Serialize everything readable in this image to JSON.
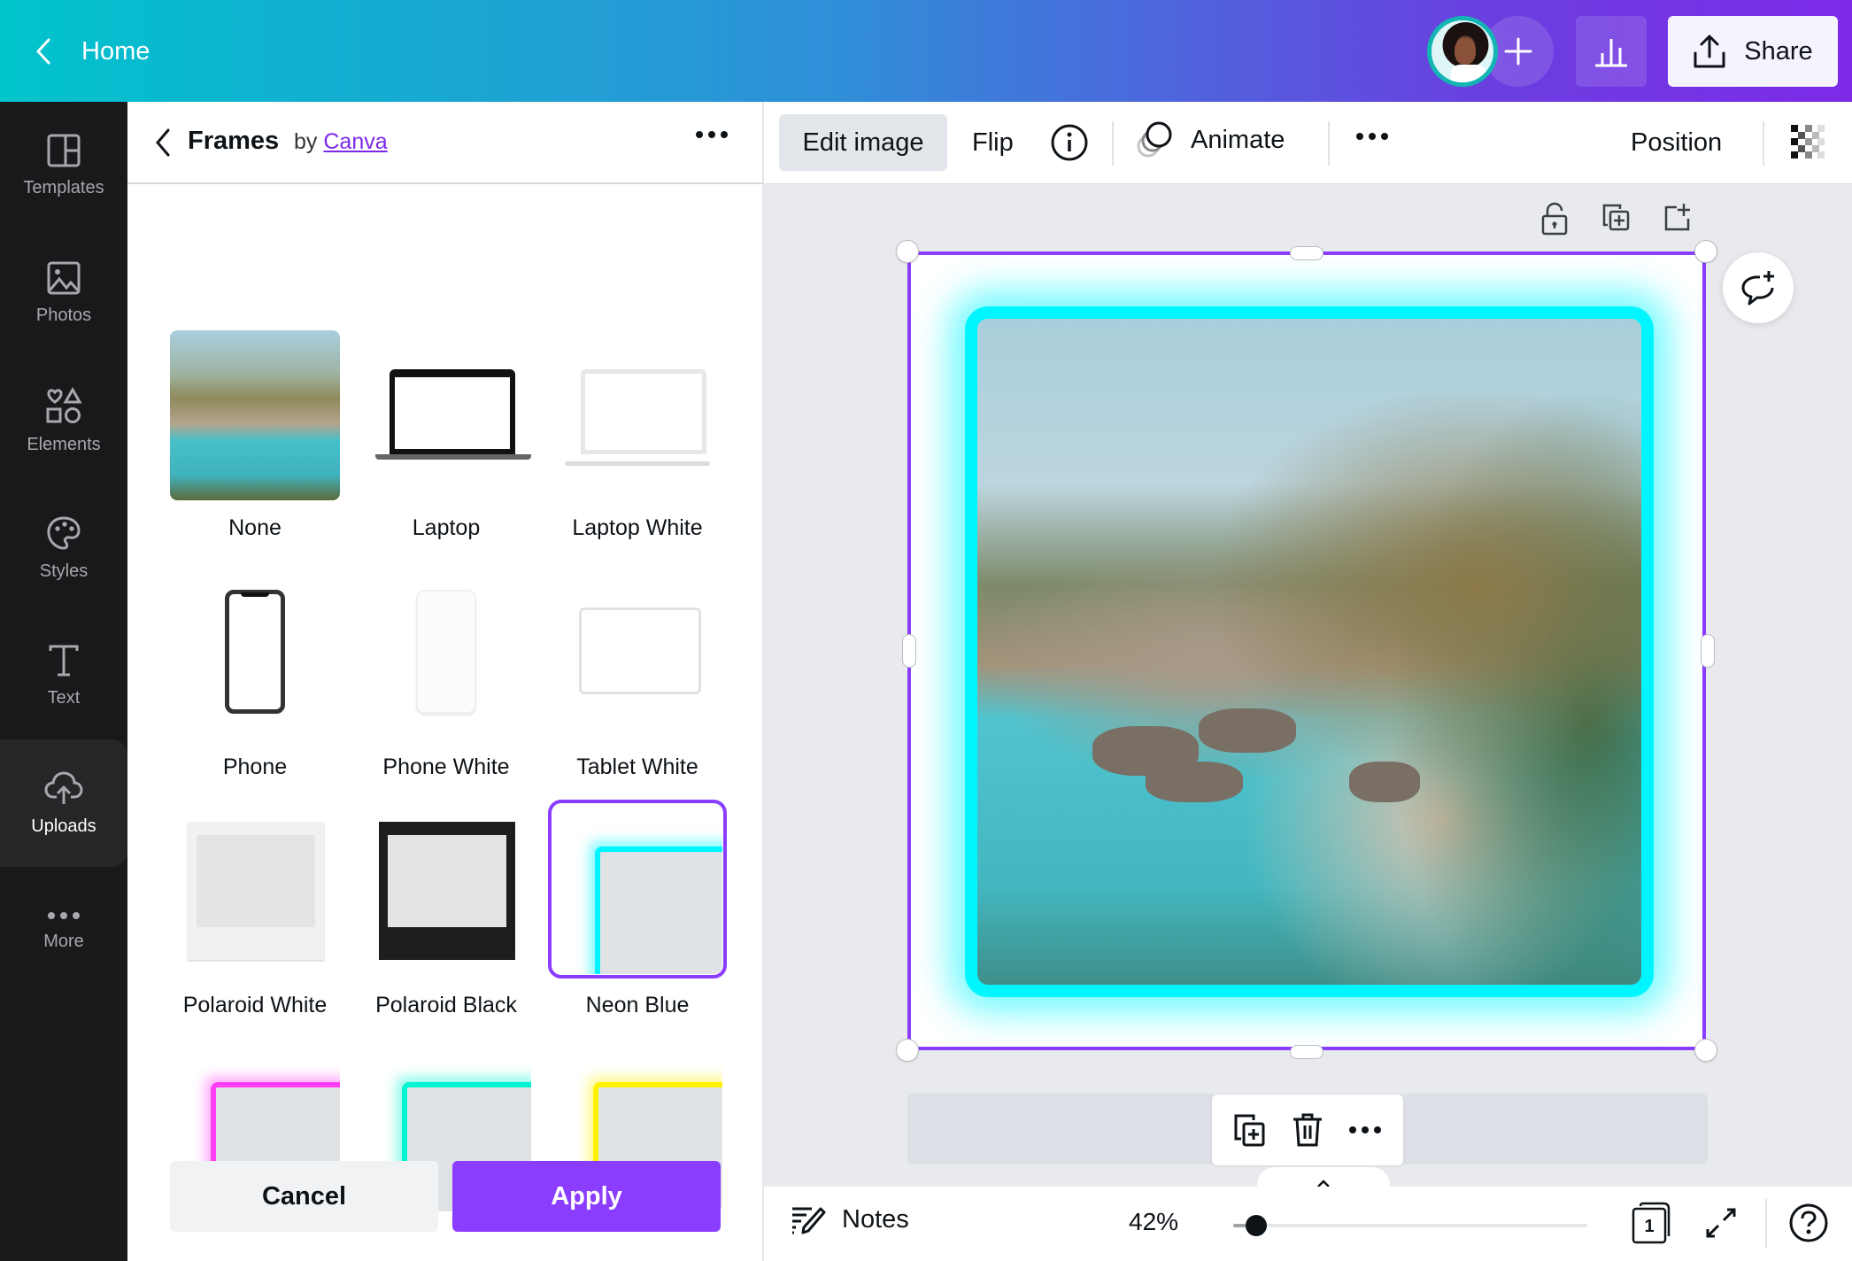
{
  "topbar": {
    "home_label": "Home",
    "share_label": "Share",
    "icons": {
      "back": "chevron-left-icon",
      "add": "plus-icon",
      "analytics": "bar-chart-icon",
      "share": "upload-icon"
    }
  },
  "sidebar": {
    "items": [
      {
        "label": "Templates",
        "icon": "templates-icon",
        "active": false
      },
      {
        "label": "Photos",
        "icon": "photos-icon",
        "active": false
      },
      {
        "label": "Elements",
        "icon": "elements-icon",
        "active": false
      },
      {
        "label": "Styles",
        "icon": "palette-icon",
        "active": false
      },
      {
        "label": "Text",
        "icon": "text-icon",
        "active": false
      },
      {
        "label": "Uploads",
        "icon": "cloud-upload-icon",
        "active": true
      },
      {
        "label": "More",
        "icon": "more-dots-icon",
        "active": false
      }
    ]
  },
  "panel": {
    "title": "Frames",
    "by_prefix": "by",
    "by_link": "Canva",
    "frames": [
      {
        "label": "None",
        "selected": false
      },
      {
        "label": "Laptop",
        "selected": false
      },
      {
        "label": "Laptop White",
        "selected": false
      },
      {
        "label": "Phone",
        "selected": false
      },
      {
        "label": "Phone White",
        "selected": false
      },
      {
        "label": "Tablet White",
        "selected": false
      },
      {
        "label": "Polaroid White",
        "selected": false
      },
      {
        "label": "Polaroid Black",
        "selected": false
      },
      {
        "label": "Neon Blue",
        "selected": true
      },
      {
        "label": "",
        "selected": false,
        "color": "#ff3df4"
      },
      {
        "label": "",
        "selected": false,
        "color": "#00f5d0"
      },
      {
        "label": "",
        "selected": false,
        "color": "#fff200"
      }
    ],
    "cancel_label": "Cancel",
    "apply_label": "Apply"
  },
  "toolbar": {
    "edit_image": "Edit image",
    "flip": "Flip",
    "animate": "Animate",
    "position": "Position"
  },
  "canvas": {
    "neon_color": "#00f6ff",
    "selection_color": "#8b3dff"
  },
  "bottombar": {
    "notes_label": "Notes",
    "zoom_label": "42%",
    "zoom_percent": 42,
    "page_count": "1"
  },
  "colors": {
    "accent": "#8b3dff",
    "sidebar_bg": "#18191b",
    "link": "#7d2ae8"
  }
}
